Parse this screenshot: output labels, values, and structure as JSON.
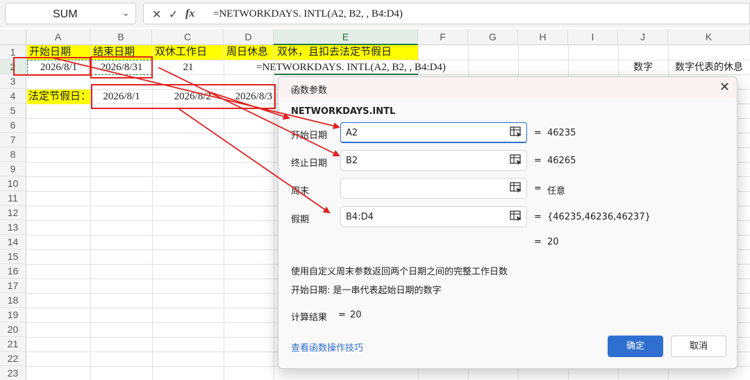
{
  "formula_bar": {
    "name_box": "SUM",
    "formula": "=NETWORKDAYS. INTL(A2, B2, , B4:D4)",
    "cancel_icon": "✕",
    "enter_icon": "✓",
    "fx_icon": "fx"
  },
  "columns": [
    "A",
    "B",
    "C",
    "D",
    "E",
    "F",
    "G",
    "H",
    "I",
    "J",
    "K"
  ],
  "rows": [
    "1",
    "2",
    "3",
    "4",
    "5",
    "6",
    "7",
    "8",
    "9",
    "10",
    "11",
    "12",
    "13",
    "14",
    "15",
    "16",
    "17",
    "18",
    "19",
    "20",
    "21",
    "22",
    "23"
  ],
  "cells": {
    "a1": "开始日期",
    "b1": "结束日期",
    "c1": "双休工作日",
    "d1": "周日休息",
    "e1": "双休，且扣去法定节假日",
    "a2": "2026/8/1",
    "b2": "2026/8/31",
    "c2": "21",
    "e2": "=NETWORKDAYS. INTL(A2, B2, , B4:D4)",
    "j2": "数字",
    "k2": "数字代表的休息",
    "a4": "法定节假日：",
    "b4": "2026/8/1",
    "c4": "2026/8/2",
    "d4": "2026/8/3"
  },
  "dialog": {
    "title": "函数参数",
    "function_name": "NETWORKDAYS.INTL",
    "args": [
      {
        "label": "开始日期",
        "value": "A2",
        "result": "46235"
      },
      {
        "label": "终止日期",
        "value": "B2",
        "result": "46265"
      },
      {
        "label": "周末",
        "value": "",
        "result": "任意"
      },
      {
        "label": "假期",
        "value": "B4:D4",
        "result": "{46235,46236,46237}"
      }
    ],
    "equals": "=",
    "total_result": "20",
    "description": "使用自定义周末参数返回两个日期之间的完整工作日数",
    "arg_description": "开始日期:  是一串代表起始日期的数字",
    "calc_label": "计算结果",
    "calc_value": "20",
    "help_link": "查看函数操作技巧",
    "ok_label": "确定",
    "cancel_label": "取消"
  },
  "colors": {
    "highlight": "#ffff00",
    "annotation_red": "#e12020",
    "accent_blue": "#2f6fd0",
    "selection_green": "#1f7a45"
  }
}
